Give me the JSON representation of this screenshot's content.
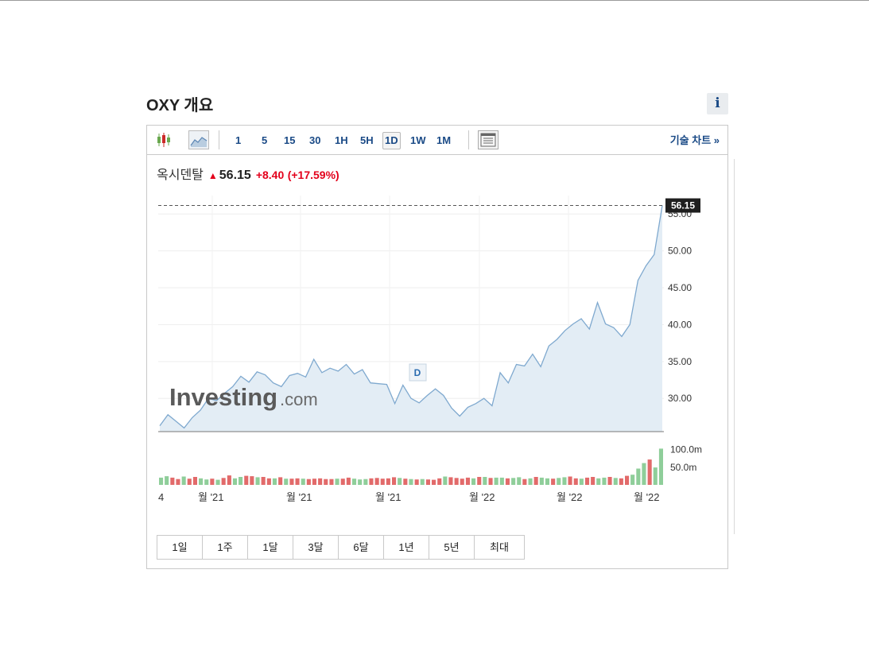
{
  "header": {
    "title": "OXY 개요",
    "info_label": "i"
  },
  "toolbar": {
    "intervals": [
      {
        "label": "1"
      },
      {
        "label": "5"
      },
      {
        "label": "15"
      },
      {
        "label": "30"
      },
      {
        "label": "1H"
      },
      {
        "label": "5H"
      },
      {
        "label": "1D",
        "selected": true
      },
      {
        "label": "1W"
      },
      {
        "label": "1M"
      }
    ],
    "tech_chart_label": "기술 차트 »",
    "icons": [
      "candlestick-icon",
      "area-chart-icon",
      "table-icon"
    ]
  },
  "quote": {
    "name": "옥시덴탈",
    "price": "56.15",
    "change": "+8.40",
    "change_pct": "(+17.59%)"
  },
  "ranges": [
    {
      "label": "1일"
    },
    {
      "label": "1주"
    },
    {
      "label": "1달"
    },
    {
      "label": "3달"
    },
    {
      "label": "6달"
    },
    {
      "label": "1년"
    },
    {
      "label": "5년"
    },
    {
      "label": "최대"
    }
  ],
  "watermark": {
    "brand": "Investing",
    "suffix": ".com"
  },
  "chart_data": {
    "type": "area",
    "last_price_label": "56.15",
    "marker_label": "D",
    "y_ticks": [
      "30.00",
      "35.00",
      "40.00",
      "45.00",
      "50.00",
      "55.00"
    ],
    "ylim": [
      25.5,
      57.5
    ],
    "x_tick_labels": [
      "4",
      "월 '21",
      "월 '21",
      "월 '21",
      "월 '22",
      "월 '22",
      "월 '22"
    ],
    "values": [
      26.3,
      27.8,
      26.9,
      26.0,
      27.4,
      28.4,
      30.0,
      29.7,
      30.7,
      31.6,
      33.0,
      32.2,
      33.6,
      33.2,
      32.1,
      31.6,
      33.1,
      33.4,
      32.9,
      35.3,
      33.5,
      34.1,
      33.7,
      34.6,
      33.3,
      33.9,
      32.1,
      32.0,
      31.9,
      29.3,
      31.8,
      30.0,
      29.4,
      30.4,
      31.3,
      30.4,
      28.7,
      27.6,
      28.8,
      29.3,
      30.0,
      29.0,
      33.5,
      32.1,
      34.6,
      34.4,
      36.0,
      34.3,
      37.1,
      38.0,
      39.2,
      40.1,
      40.8,
      39.4,
      43.0,
      40.1,
      39.6,
      38.4,
      40.0,
      46.0,
      48.0,
      49.5,
      56.15
    ],
    "volume": {
      "ticks": [
        "100.0m",
        "50.0m"
      ],
      "ylim": [
        0,
        125
      ],
      "values": [
        20,
        24,
        20,
        16,
        23,
        17,
        22,
        18,
        15,
        17,
        14,
        19,
        26,
        18,
        22,
        25,
        24,
        21,
        22,
        18,
        18,
        21,
        17,
        17,
        18,
        17,
        16,
        17,
        18,
        16,
        16,
        17,
        17,
        20,
        17,
        15,
        16,
        18,
        19,
        17,
        18,
        21,
        19,
        17,
        16,
        15,
        16,
        15,
        14,
        18,
        23,
        21,
        19,
        17,
        20,
        18,
        22,
        22,
        19,
        20,
        20,
        18,
        19,
        21,
        16,
        18,
        22,
        20,
        18,
        17,
        19,
        21,
        23,
        18,
        17,
        20,
        22,
        18,
        20,
        22,
        19,
        18,
        25,
        28,
        45,
        60,
        70,
        48,
        100
      ],
      "up": [
        true,
        true,
        false,
        false,
        true,
        false,
        false,
        true,
        true,
        false,
        true,
        false,
        false,
        true,
        true,
        false,
        false,
        true,
        false,
        false,
        true,
        false,
        true,
        false,
        false,
        true,
        false,
        false,
        false,
        false,
        false,
        true,
        false,
        false,
        true,
        true,
        true,
        false,
        false,
        false,
        false,
        false,
        true,
        false,
        true,
        false,
        true,
        false,
        false,
        false,
        true,
        false,
        false,
        false,
        false,
        true,
        false,
        true,
        false,
        true,
        true,
        false,
        true,
        true,
        false,
        true,
        false,
        true,
        true,
        false,
        true,
        true,
        false,
        false,
        true,
        false,
        false,
        true,
        true,
        false,
        true,
        false,
        false,
        true,
        true,
        true,
        false,
        true,
        true
      ]
    }
  }
}
